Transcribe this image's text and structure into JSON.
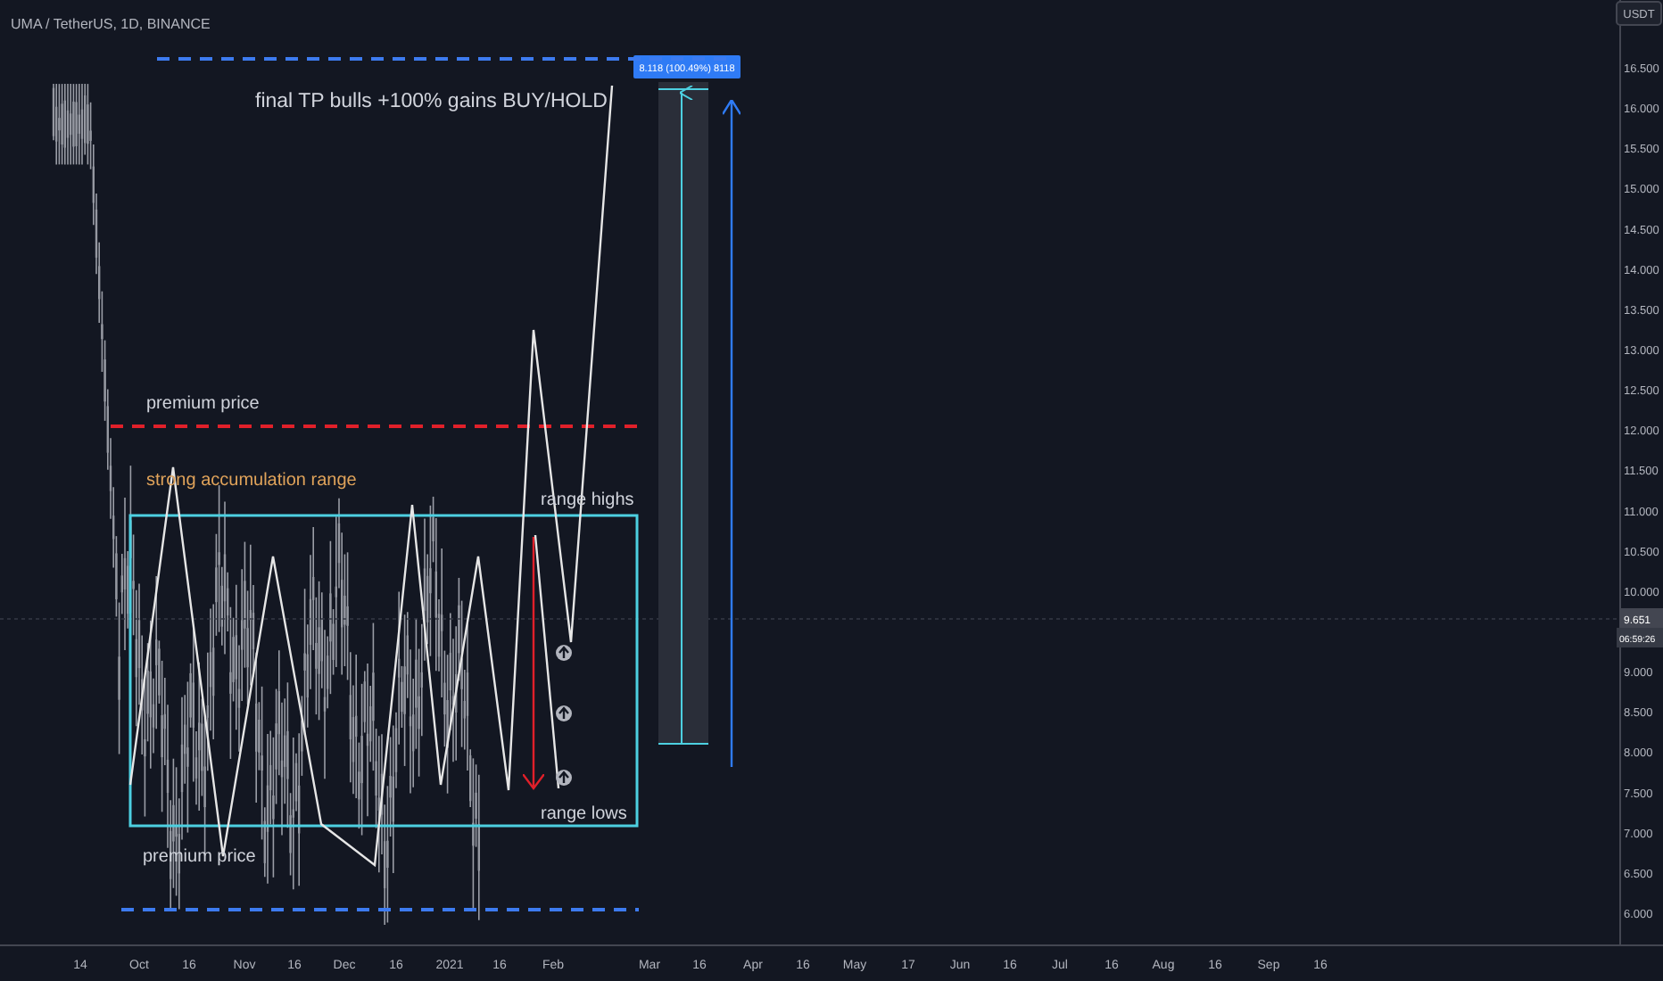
{
  "header": {
    "symbol": "UMA / TetherUS, 1D, BINANCE"
  },
  "price_axis": {
    "currency": "USDT",
    "ticks": [
      "16.500",
      "16.000",
      "15.500",
      "15.000",
      "14.500",
      "14.000",
      "13.500",
      "13.000",
      "12.500",
      "12.000",
      "11.500",
      "11.000",
      "10.500",
      "10.000",
      "9.000",
      "8.500",
      "8.000",
      "7.500",
      "7.000",
      "6.500",
      "6.000"
    ],
    "last_price": "9.651",
    "countdown": "06:59:26"
  },
  "time_axis": {
    "ticks": [
      "14",
      "Oct",
      "16",
      "Nov",
      "16",
      "Dec",
      "16",
      "2021",
      "16",
      "Feb",
      "Mar",
      "16",
      "Apr",
      "16",
      "May",
      "17",
      "Jun",
      "16",
      "Jul",
      "16",
      "Aug",
      "16",
      "Sep",
      "16"
    ]
  },
  "annotations": [
    {
      "kind": "title",
      "text": "final TP bulls +100% gains BUY/HOLD",
      "color": "#d1d4dc"
    },
    {
      "kind": "label",
      "text": "premium price",
      "color": "#d1d4dc"
    },
    {
      "kind": "label",
      "text": "strong accumulation range",
      "color": "#e0a35a"
    },
    {
      "kind": "label",
      "text": "range highs",
      "color": "#d1d4dc"
    },
    {
      "kind": "label",
      "text": "range lows",
      "color": "#d1d4dc"
    },
    {
      "kind": "label",
      "text": "premium price",
      "color": "#d1d4dc"
    }
  ],
  "measure": {
    "label": "8.118 (100.49%) 8118"
  }
}
